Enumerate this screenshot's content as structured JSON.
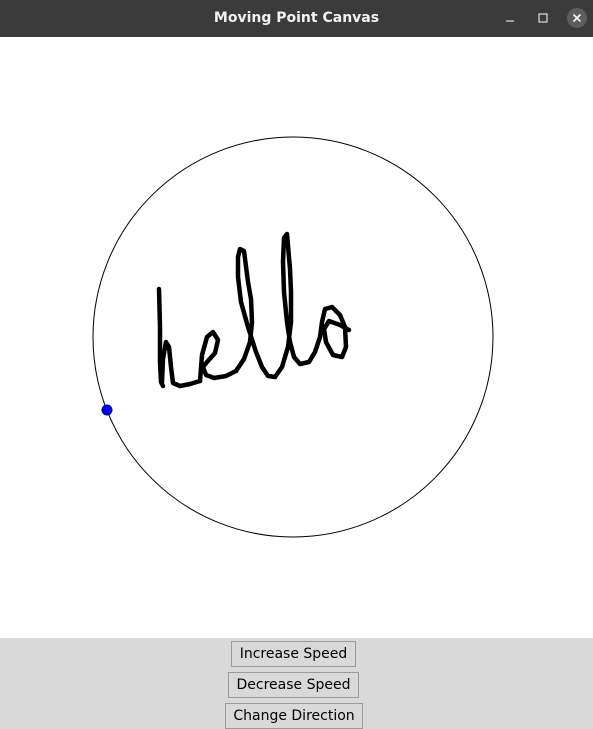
{
  "window": {
    "title": "Moving Point Canvas",
    "controls": {
      "minimize_icon": "minimize-icon",
      "maximize_icon": "maximize-icon",
      "close_icon": "close-icon"
    }
  },
  "canvas": {
    "handwriting_text": "hello",
    "circle_color": "#000000",
    "point_color": "#0000ff"
  },
  "buttons": {
    "increase_speed": "Increase Speed",
    "decrease_speed": "Decrease Speed",
    "change_direction": "Change Direction"
  },
  "colors": {
    "titlebar": "#3b3b3b",
    "button_bar": "#d9d9d9",
    "canvas_bg": "#ffffff"
  }
}
